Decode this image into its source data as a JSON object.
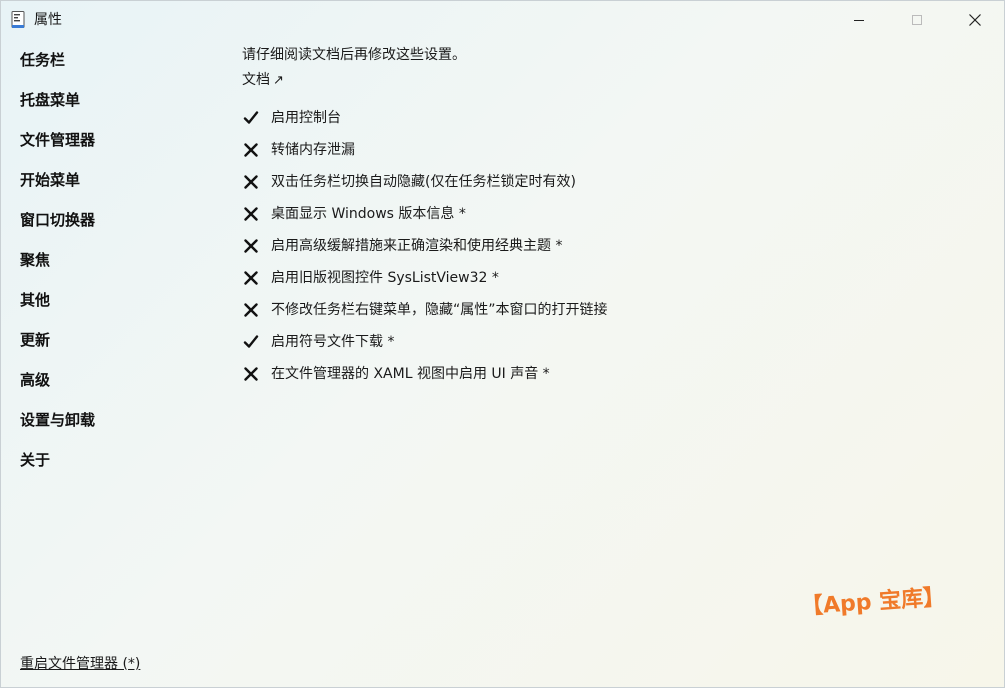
{
  "window": {
    "title": "属性"
  },
  "sidebar": {
    "items": [
      {
        "label": "任务栏"
      },
      {
        "label": "托盘菜单"
      },
      {
        "label": "文件管理器"
      },
      {
        "label": "开始菜单"
      },
      {
        "label": "窗口切换器"
      },
      {
        "label": "聚焦"
      },
      {
        "label": "其他"
      },
      {
        "label": "更新"
      },
      {
        "label": "高级"
      },
      {
        "label": "设置与卸载"
      },
      {
        "label": "关于"
      }
    ],
    "restart_link": "重启文件管理器 (*)"
  },
  "main": {
    "instruction": "请仔细阅读文档后再修改这些设置。",
    "docs_link": "文档",
    "docs_arrow": "↗",
    "settings": [
      {
        "label": "启用控制台",
        "enabled": true
      },
      {
        "label": "转储内存泄漏",
        "enabled": false
      },
      {
        "label": "双击任务栏切换自动隐藏(仅在任务栏锁定时有效)",
        "enabled": false
      },
      {
        "label": "桌面显示 Windows 版本信息 *",
        "enabled": false
      },
      {
        "label": "启用高级缓解措施来正确渲染和使用经典主题 *",
        "enabled": false
      },
      {
        "label": "启用旧版视图控件 SysListView32 *",
        "enabled": false
      },
      {
        "label": "不修改任务栏右键菜单，隐藏“属性”本窗口的打开链接",
        "enabled": false
      },
      {
        "label": "启用符号文件下载 *",
        "enabled": true
      },
      {
        "label": "在文件管理器的 XAML 视图中启用 UI 声音 *",
        "enabled": false
      }
    ]
  },
  "watermark": {
    "text": "【App 宝库】",
    "color": "#f07a2a"
  }
}
